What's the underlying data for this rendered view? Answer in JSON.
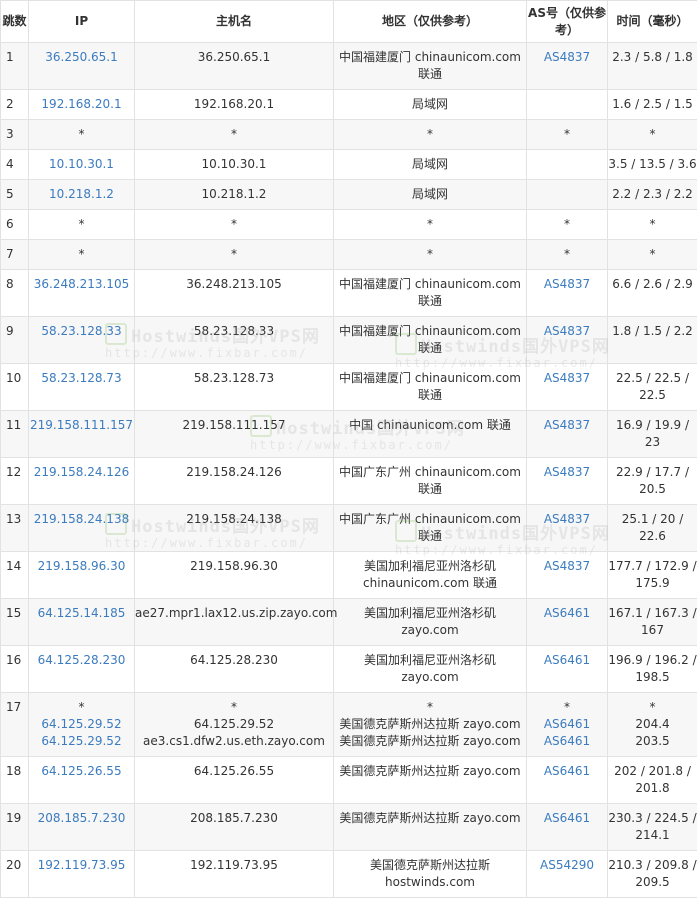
{
  "headers": {
    "hop": "跳数",
    "ip": "IP",
    "host": "主机名",
    "region": "地区（仅供参考）",
    "asn": "AS号（仅供参考）",
    "time": "时间（毫秒）"
  },
  "rows": [
    {
      "hop": "1",
      "ips": [
        "36.250.65.1"
      ],
      "hosts": [
        "36.250.65.1"
      ],
      "regions": [
        "中国福建厦门 chinaunicom.com 联通"
      ],
      "asns": [
        "AS4837"
      ],
      "times": [
        "2.3 / 5.8 / 1.8"
      ]
    },
    {
      "hop": "2",
      "ips": [
        "192.168.20.1"
      ],
      "hosts": [
        "192.168.20.1"
      ],
      "regions": [
        "局域网"
      ],
      "asns": [
        ""
      ],
      "times": [
        "1.6 / 2.5 / 1.5"
      ]
    },
    {
      "hop": "3",
      "ips": [
        "*"
      ],
      "hosts": [
        "*"
      ],
      "regions": [
        "*"
      ],
      "asns": [
        "*"
      ],
      "times": [
        "*"
      ]
    },
    {
      "hop": "4",
      "ips": [
        "10.10.30.1"
      ],
      "hosts": [
        "10.10.30.1"
      ],
      "regions": [
        "局域网"
      ],
      "asns": [
        ""
      ],
      "times": [
        "3.5 / 13.5 / 3.6"
      ]
    },
    {
      "hop": "5",
      "ips": [
        "10.218.1.2"
      ],
      "hosts": [
        "10.218.1.2"
      ],
      "regions": [
        "局域网"
      ],
      "asns": [
        ""
      ],
      "times": [
        "2.2 / 2.3 / 2.2"
      ]
    },
    {
      "hop": "6",
      "ips": [
        "*"
      ],
      "hosts": [
        "*"
      ],
      "regions": [
        "*"
      ],
      "asns": [
        "*"
      ],
      "times": [
        "*"
      ]
    },
    {
      "hop": "7",
      "ips": [
        "*"
      ],
      "hosts": [
        "*"
      ],
      "regions": [
        "*"
      ],
      "asns": [
        "*"
      ],
      "times": [
        "*"
      ]
    },
    {
      "hop": "8",
      "ips": [
        "36.248.213.105"
      ],
      "hosts": [
        "36.248.213.105"
      ],
      "regions": [
        "中国福建厦门 chinaunicom.com 联通"
      ],
      "asns": [
        "AS4837"
      ],
      "times": [
        "6.6 / 2.6 / 2.9"
      ]
    },
    {
      "hop": "9",
      "ips": [
        "58.23.128.33"
      ],
      "hosts": [
        "58.23.128.33"
      ],
      "regions": [
        "中国福建厦门 chinaunicom.com 联通"
      ],
      "asns": [
        "AS4837"
      ],
      "times": [
        "1.8 / 1.5 / 2.2"
      ]
    },
    {
      "hop": "10",
      "ips": [
        "58.23.128.73"
      ],
      "hosts": [
        "58.23.128.73"
      ],
      "regions": [
        "中国福建厦门 chinaunicom.com 联通"
      ],
      "asns": [
        "AS4837"
      ],
      "times": [
        "22.5 / 22.5 / 22.5"
      ]
    },
    {
      "hop": "11",
      "ips": [
        "219.158.111.157"
      ],
      "hosts": [
        "219.158.111.157"
      ],
      "regions": [
        "中国 chinaunicom.com 联通"
      ],
      "asns": [
        "AS4837"
      ],
      "times": [
        "16.9 / 19.9 / 23"
      ]
    },
    {
      "hop": "12",
      "ips": [
        "219.158.24.126"
      ],
      "hosts": [
        "219.158.24.126"
      ],
      "regions": [
        "中国广东广州 chinaunicom.com 联通"
      ],
      "asns": [
        "AS4837"
      ],
      "times": [
        "22.9 / 17.7 / 20.5"
      ]
    },
    {
      "hop": "13",
      "ips": [
        "219.158.24.138"
      ],
      "hosts": [
        "219.158.24.138"
      ],
      "regions": [
        "中国广东广州 chinaunicom.com 联通"
      ],
      "asns": [
        "AS4837"
      ],
      "times": [
        "25.1 / 20 / 22.6"
      ]
    },
    {
      "hop": "14",
      "ips": [
        "219.158.96.30"
      ],
      "hosts": [
        "219.158.96.30"
      ],
      "regions": [
        "美国加利福尼亚州洛杉矶 chinaunicom.com 联通"
      ],
      "asns": [
        "AS4837"
      ],
      "times": [
        "177.7 / 172.9 / 175.9"
      ]
    },
    {
      "hop": "15",
      "ips": [
        "64.125.14.185"
      ],
      "hosts": [
        "ae27.mpr1.lax12.us.zip.zayo.com"
      ],
      "regions": [
        "美国加利福尼亚州洛杉矶 zayo.com"
      ],
      "asns": [
        "AS6461"
      ],
      "times": [
        "167.1 / 167.3 / 167"
      ]
    },
    {
      "hop": "16",
      "ips": [
        "64.125.28.230"
      ],
      "hosts": [
        "64.125.28.230"
      ],
      "regions": [
        "美国加利福尼亚州洛杉矶 zayo.com"
      ],
      "asns": [
        "AS6461"
      ],
      "times": [
        "196.9 / 196.2 / 198.5"
      ]
    },
    {
      "hop": "17",
      "ips": [
        "*",
        "64.125.29.52",
        "64.125.29.52"
      ],
      "hosts": [
        "*",
        "64.125.29.52",
        "ae3.cs1.dfw2.us.eth.zayo.com"
      ],
      "regions": [
        "*",
        "美国德克萨斯州达拉斯 zayo.com",
        "美国德克萨斯州达拉斯 zayo.com"
      ],
      "asns": [
        "*",
        "AS6461",
        "AS6461"
      ],
      "times": [
        "*",
        "204.4",
        "203.5"
      ]
    },
    {
      "hop": "18",
      "ips": [
        "64.125.26.55"
      ],
      "hosts": [
        "64.125.26.55"
      ],
      "regions": [
        "美国德克萨斯州达拉斯 zayo.com"
      ],
      "asns": [
        "AS6461"
      ],
      "times": [
        "202 / 201.8 / 201.8"
      ]
    },
    {
      "hop": "19",
      "ips": [
        "208.185.7.230"
      ],
      "hosts": [
        "208.185.7.230"
      ],
      "regions": [
        "美国德克萨斯州达拉斯 zayo.com"
      ],
      "asns": [
        "AS6461"
      ],
      "times": [
        "230.3 / 224.5 / 214.1"
      ]
    },
    {
      "hop": "20",
      "ips": [
        "192.119.73.95"
      ],
      "hosts": [
        "192.119.73.95"
      ],
      "regions": [
        "美国德克萨斯州达拉斯 hostwinds.com"
      ],
      "asns": [
        "AS54290"
      ],
      "times": [
        "210.3 / 209.8 / 209.5"
      ]
    }
  ],
  "watermark": {
    "title": "Hostwinds国外VPS网",
    "url": "http://www.fixbar.com/"
  }
}
